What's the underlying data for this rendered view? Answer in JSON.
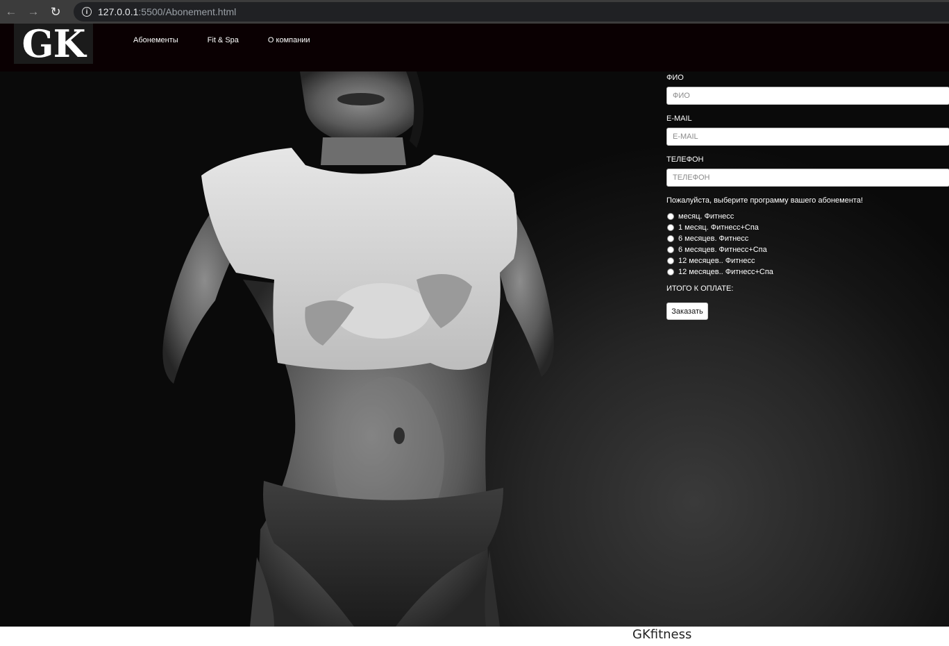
{
  "browser": {
    "url_host": "127.0.0.1",
    "url_rest": ":5500/Abonement.html",
    "icons": [
      "back-arrow-icon",
      "forward-arrow-icon",
      "reload-icon",
      "info-icon"
    ]
  },
  "header": {
    "logo": "GK",
    "nav": [
      "Абонементы",
      "Fit & Spa",
      "О компании"
    ]
  },
  "form": {
    "name_label": "ФИО",
    "name_placeholder": "ФИО",
    "email_label": "E-MAIL",
    "email_placeholder": "E-MAIL",
    "phone_label": "ТЕЛЕФОН",
    "phone_placeholder": "ТЕЛЕФОН",
    "prompt": "Пожалуйста, выберите программу вашего абонемента!",
    "options": [
      "месяц. Фитнесс",
      "1 месяц. Фитнесс+Спа",
      "6 месяцев. Фитнесс",
      "6 месяцев. Фитнесс+Спа",
      "12 месяцев.. Фитнесс",
      "12 месяцев.. Фитнесс+Спа"
    ],
    "total_label": "ИТОГО К ОПЛАТЕ:",
    "submit_label": "Заказать"
  },
  "footer": {
    "brand": "GKfitness"
  },
  "colors": {
    "header_bg": "#0a0002",
    "hero_bg": "#1a1a1a"
  }
}
